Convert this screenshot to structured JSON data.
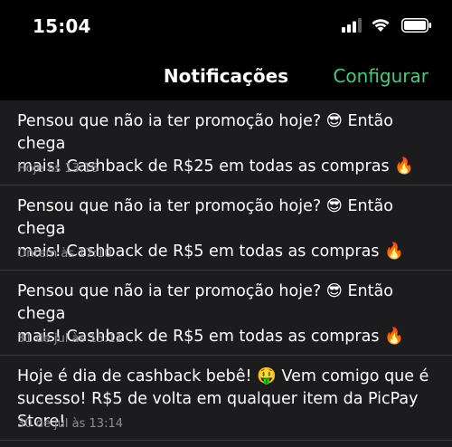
{
  "status_bar": {
    "time": "15:04",
    "icons": [
      "cellular-signal-icon",
      "wifi-icon",
      "battery-icon"
    ]
  },
  "nav": {
    "title": "Notificações",
    "action_label": "Configurar",
    "action_color": "#4cc97a"
  },
  "notifications": [
    {
      "text": "Pensou que não ia ter promoção hoje? 😎 Então chega\nmais! Cashback de R$25 em todas as compras 🔥",
      "time": "Hoje às 13:16"
    },
    {
      "text": "Pensou que não ia ter promoção hoje? 😎 Então chega\nmais! Cashback de R$5 em todas as compras 🔥",
      "time": "Ontem às 17:10"
    },
    {
      "text": "Pensou que não ia ter promoção hoje? 😎 Então chega\nmais! Cashback de R$5 em todas as compras 🔥",
      "time": "31 de jul às 15:11"
    },
    {
      "text": "Hoje é dia de cashback bebê! 🤑 Vem comigo que é\nsucesso! R$5 de volta em qualquer item da PicPay Store!",
      "time": "30 de jul às 13:14"
    }
  ]
}
